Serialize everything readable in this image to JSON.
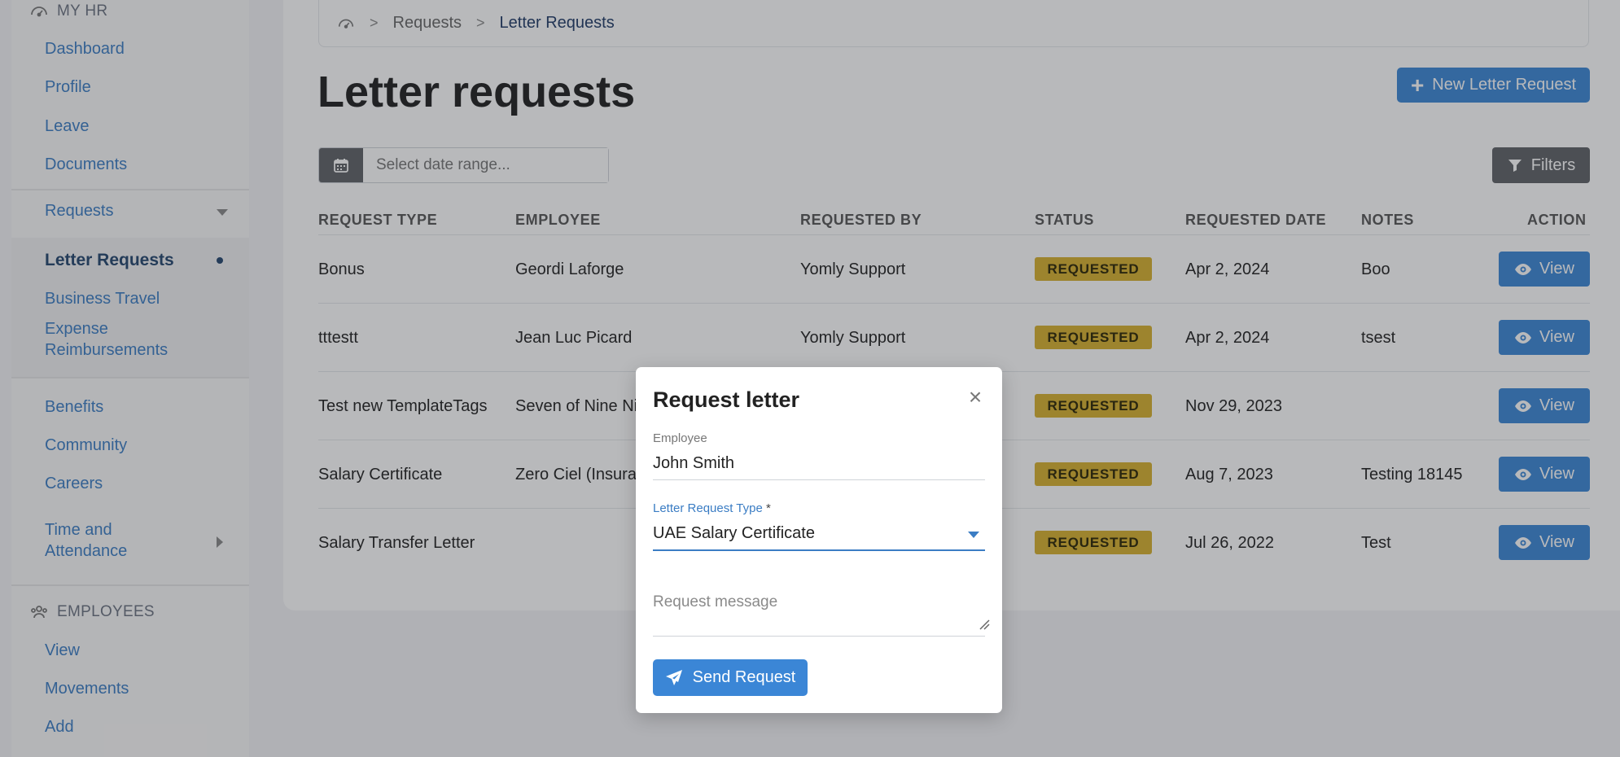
{
  "sidebar": {
    "my_hr_heading": "MY HR",
    "items": [
      {
        "label": "Dashboard"
      },
      {
        "label": "Profile"
      },
      {
        "label": "Leave"
      },
      {
        "label": "Documents"
      },
      {
        "label": "Requests"
      },
      {
        "label": "Letter Requests"
      },
      {
        "label": "Business Travel"
      },
      {
        "label": "Expense Reimbursements"
      },
      {
        "label": "Benefits"
      },
      {
        "label": "Community"
      },
      {
        "label": "Careers"
      },
      {
        "label": "Time and Attendance"
      }
    ],
    "employees_heading": "EMPLOYEES",
    "employee_items": [
      {
        "label": "View"
      },
      {
        "label": "Movements"
      },
      {
        "label": "Add"
      }
    ]
  },
  "breadcrumb": {
    "home_icon": "dashboard-gauge-icon",
    "items": [
      "Requests",
      "Letter Requests"
    ],
    "separator": ">"
  },
  "page": {
    "title": "Letter requests",
    "new_button_label": "New Letter Request",
    "date_placeholder": "Select date range...",
    "filters_label": "Filters"
  },
  "table": {
    "columns": [
      "REQUEST TYPE",
      "EMPLOYEE",
      "REQUESTED BY",
      "STATUS",
      "REQUESTED DATE",
      "NOTES",
      "ACTION"
    ],
    "rows": [
      {
        "type": "Bonus",
        "employee": "Geordi Laforge",
        "requested_by": "Yomly Support",
        "status": "REQUESTED",
        "date": "Apr 2, 2024",
        "notes": "Boo",
        "action": "View"
      },
      {
        "type": "tttestt",
        "employee": "Jean Luc Picard",
        "requested_by": "Yomly Support",
        "status": "REQUESTED",
        "date": "Apr 2, 2024",
        "notes": "tsest",
        "action": "View"
      },
      {
        "type": "Test new TemplateTags",
        "employee": "Seven of Nine Ni",
        "requested_by": "",
        "status": "REQUESTED",
        "date": "Nov 29, 2023",
        "notes": "",
        "action": "View"
      },
      {
        "type": "Salary Certificate",
        "employee": "Zero Ciel (Insurar",
        "requested_by": "",
        "status": "REQUESTED",
        "date": "Aug 7, 2023",
        "notes": "Testing 18145",
        "action": "View"
      },
      {
        "type": "Salary Transfer Letter",
        "employee": "",
        "requested_by": "",
        "status": "REQUESTED",
        "date": "Jul 26, 2022",
        "notes": "Test",
        "action": "View"
      }
    ]
  },
  "modal": {
    "title": "Request letter",
    "close_symbol": "×",
    "employee_label": "Employee",
    "employee_value": "John Smith",
    "letter_type_label": "Letter Request Type",
    "letter_type_required": "*",
    "letter_type_value": "UAE Salary Certificate",
    "message_placeholder": "Request message",
    "send_label": "Send Request"
  },
  "colors": {
    "primary": "#3b86d6",
    "badge": "#d7b12e",
    "nav_link": "#3b7dc4",
    "nav_active": "#23456e",
    "dark_button": "#5f6266"
  }
}
